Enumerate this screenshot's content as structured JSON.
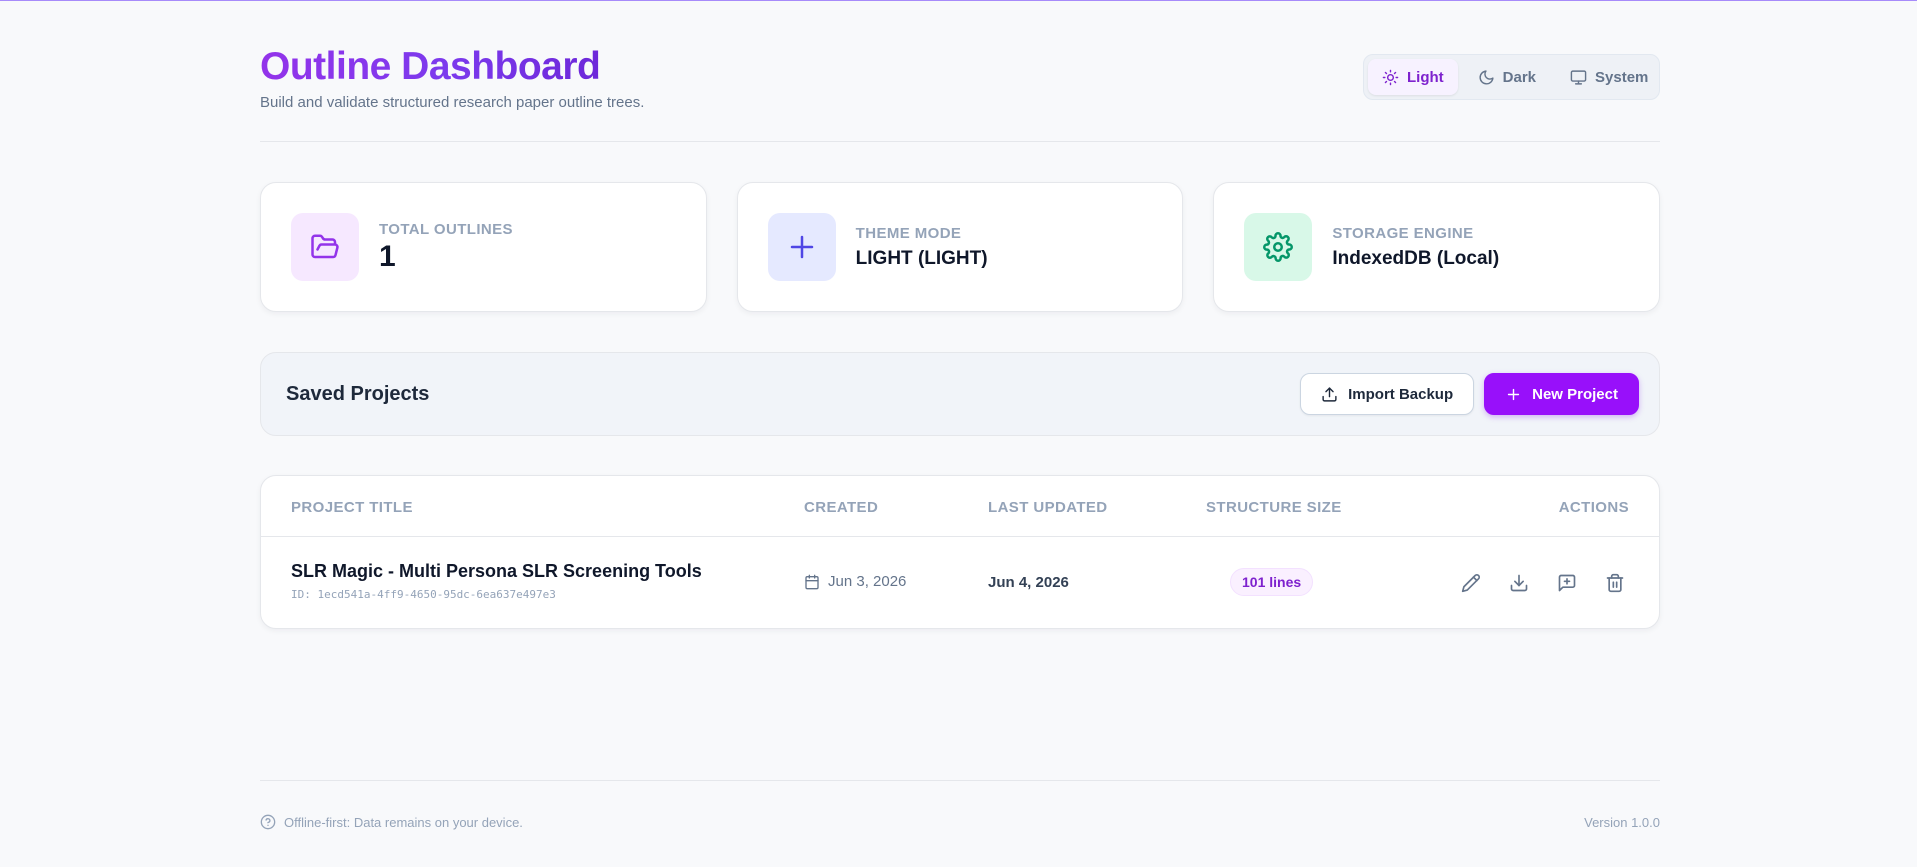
{
  "header": {
    "title": "Outline Dashboard",
    "subtitle": "Build and validate structured research paper outline trees."
  },
  "theme_toggle": {
    "options": [
      {
        "label": "Light",
        "icon": "sun-icon",
        "active": true
      },
      {
        "label": "Dark",
        "icon": "moon-icon",
        "active": false
      },
      {
        "label": "System",
        "icon": "monitor-icon",
        "active": false
      }
    ]
  },
  "stats": [
    {
      "label": "Total Outlines",
      "value": "1",
      "icon": "folder-open-icon",
      "icon_color": "#9333ea",
      "icon_bg": "#f6e8ff"
    },
    {
      "label": "Theme Mode",
      "value": "LIGHT (LIGHT)",
      "icon": "plus-icon",
      "icon_color": "#4f46e5",
      "icon_bg": "#e5e9ff"
    },
    {
      "label": "Storage Engine",
      "value": "IndexedDB (Local)",
      "icon": "gear-icon",
      "icon_color": "#059669",
      "icon_bg": "#d8f8e8"
    }
  ],
  "projects": {
    "title": "Saved Projects",
    "import_label": "Import Backup",
    "new_label": "New Project"
  },
  "table": {
    "columns": [
      "Project Title",
      "Created",
      "Last Updated",
      "Structure Size",
      "Actions"
    ],
    "rows": [
      {
        "title": "SLR Magic - Multi Persona SLR Screening Tools",
        "id": "ID: 1ecd541a-4ff9-4650-95dc-6ea637e497e3",
        "created": "Jun 3, 2026",
        "updated": "Jun 4, 2026",
        "size": "101 lines"
      }
    ]
  },
  "footer": {
    "note": "Offline-first: Data remains on your device.",
    "version": "Version 1.0.0"
  },
  "colors": {
    "accent": "#9810fa",
    "accent_text": "#7e22ce"
  }
}
